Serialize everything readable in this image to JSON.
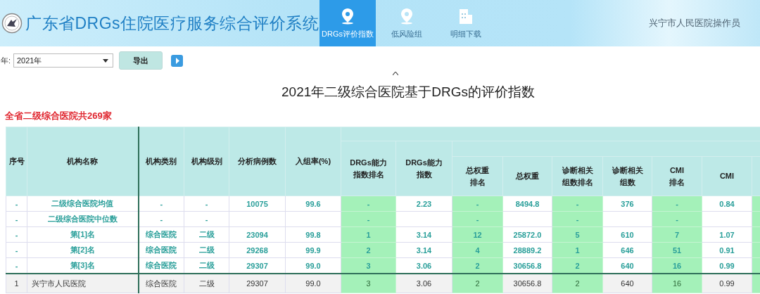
{
  "header": {
    "title": "广东省DRGs住院医疗服务综合评价系统",
    "nav": [
      {
        "label": "DRGs评价指数",
        "selected": true,
        "kind": "pin"
      },
      {
        "label": "低风险组",
        "selected": false,
        "kind": "pin"
      },
      {
        "label": "明细下载",
        "selected": false,
        "kind": "building"
      }
    ],
    "user": "兴宁市人民医院操作员"
  },
  "toolbar": {
    "year_label": "年:",
    "year": "2021年",
    "export": "导出"
  },
  "report": {
    "title": "2021年二级综合医院基于DRGs的评价指数",
    "subtitle": "全省二级综合医院共269家",
    "columns": [
      {
        "label": "序号",
        "kind": "info"
      },
      {
        "label": "机构名称",
        "kind": "info"
      },
      {
        "label": "机构类别",
        "kind": "info"
      },
      {
        "label": "机构级别",
        "kind": "info"
      },
      {
        "label": "分析病例数",
        "kind": "info"
      },
      {
        "label": "入组率(%)",
        "kind": "info"
      },
      {
        "label": "DRGs能力指数排名",
        "kind": "rank"
      },
      {
        "label": "DRGs能力指数",
        "kind": "value"
      },
      {
        "label": "总权重排名",
        "kind": "rank"
      },
      {
        "label": "总权重",
        "kind": "value"
      },
      {
        "label": "诊断相关组数排名",
        "kind": "rank"
      },
      {
        "label": "诊断相关组数",
        "kind": "value"
      },
      {
        "label": "CMI排名",
        "kind": "rank"
      },
      {
        "label": "CMI",
        "kind": "value"
      }
    ],
    "rows": [
      {
        "kind": "benchmark",
        "cells": [
          "-",
          "二级综合医院均值",
          "-",
          "-",
          "10075",
          "99.6",
          "-",
          "2.23",
          "-",
          "8494.8",
          "-",
          "376",
          "-",
          "0.84"
        ]
      },
      {
        "kind": "benchmark",
        "cells": [
          "-",
          "二级综合医院中位数",
          "-",
          "-",
          null,
          null,
          "-",
          null,
          "-",
          null,
          "-",
          null,
          "-",
          null
        ]
      },
      {
        "kind": "benchmark",
        "cells": [
          "-",
          "第[1]名",
          "综合医院",
          "二级",
          "23094",
          "99.8",
          "1",
          "3.14",
          "12",
          "25872.0",
          "5",
          "610",
          "7",
          "1.07"
        ]
      },
      {
        "kind": "benchmark",
        "cells": [
          "-",
          "第[2]名",
          "综合医院",
          "二级",
          "29268",
          "99.9",
          "2",
          "3.14",
          "4",
          "28889.2",
          "1",
          "646",
          "51",
          "0.91"
        ]
      },
      {
        "kind": "benchmark",
        "cells": [
          "-",
          "第[3]名",
          "综合医院",
          "二级",
          "29307",
          "99.0",
          "3",
          "3.06",
          "2",
          "30656.8",
          "2",
          "640",
          "16",
          "0.99"
        ]
      },
      {
        "kind": "own",
        "cells": [
          "1",
          "兴宁市人民医院",
          "综合医院",
          "二级",
          "29307",
          "99.0",
          "3",
          "3.06",
          "2",
          "30656.8",
          "2",
          "640",
          "16",
          "0.99"
        ]
      }
    ]
  }
}
